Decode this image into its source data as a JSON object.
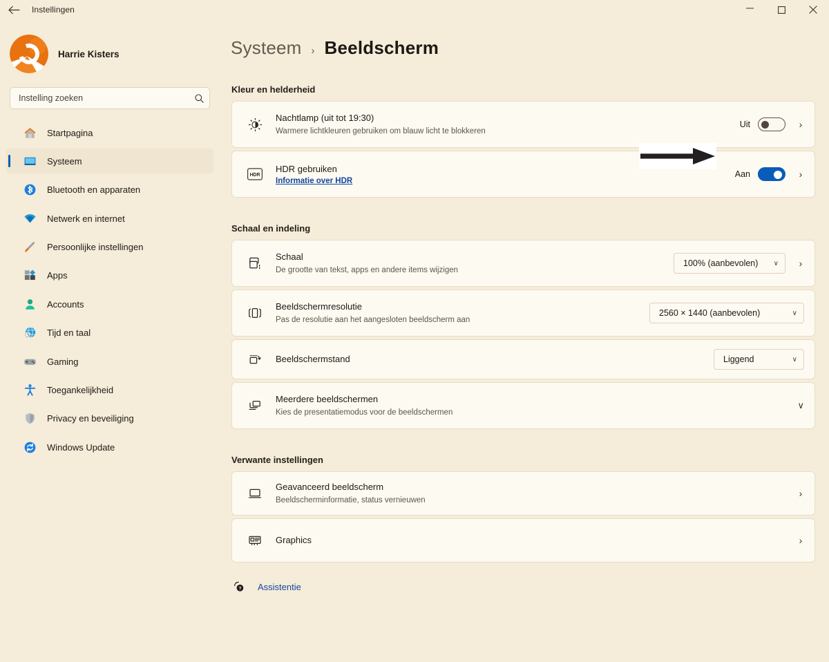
{
  "window": {
    "title": "Instellingen",
    "back_icon": "arrow-left-icon",
    "minimize_label": "–",
    "maximize_label": "□",
    "close_label": "×"
  },
  "sidebar": {
    "profile": {
      "name": "Harrie Kisters",
      "avatar_icon": "user-avatar"
    },
    "search": {
      "placeholder": "Instelling zoeken",
      "value": "",
      "icon": "search-icon"
    },
    "items": [
      {
        "label": "Startpagina",
        "icon": "home-icon",
        "active": false
      },
      {
        "label": "Systeem",
        "icon": "monitor-icon",
        "active": true
      },
      {
        "label": "Bluetooth en apparaten",
        "icon": "bluetooth-icon",
        "active": false
      },
      {
        "label": "Netwerk en internet",
        "icon": "wifi-icon",
        "active": false
      },
      {
        "label": "Persoonlijke instellingen",
        "icon": "brush-icon",
        "active": false
      },
      {
        "label": "Apps",
        "icon": "apps-icon",
        "active": false
      },
      {
        "label": "Accounts",
        "icon": "account-icon",
        "active": false
      },
      {
        "label": "Tijd en taal",
        "icon": "clock-globe-icon",
        "active": false
      },
      {
        "label": "Gaming",
        "icon": "gamepad-icon",
        "active": false
      },
      {
        "label": "Toegankelijkheid",
        "icon": "accessibility-icon",
        "active": false
      },
      {
        "label": "Privacy en beveiliging",
        "icon": "shield-icon",
        "active": false
      },
      {
        "label": "Windows Update",
        "icon": "update-icon",
        "active": false
      }
    ]
  },
  "breadcrumb": {
    "parent": "Systeem",
    "separator": "›",
    "current": "Beeldscherm"
  },
  "sections": [
    {
      "title": "Kleur en helderheid",
      "cards": [
        {
          "icon": "night-light-icon",
          "title": "Nachtlamp (uit tot 19:30)",
          "subtitle": "Warmere lichtkleuren gebruiken om blauw licht te blokkeren",
          "state_label": "Uit",
          "toggle": "off",
          "chevron": "›"
        },
        {
          "icon": "hdr-icon",
          "title": "HDR gebruiken",
          "link": "Informatie over HDR",
          "state_label": "Aan",
          "toggle": "on",
          "chevron": "›"
        }
      ]
    },
    {
      "title": "Schaal en indeling",
      "cards": [
        {
          "icon": "scale-icon",
          "title": "Schaal",
          "subtitle": "De grootte van tekst, apps en andere items wijzigen",
          "dropdown_value": "100% (aanbevolen)",
          "dropdown_caret": "∨",
          "chevron": "›"
        },
        {
          "icon": "resolution-icon",
          "title": "Beeldschermresolutie",
          "subtitle": "Pas de resolutie aan het aangesloten beeldscherm aan",
          "dropdown_value": "2560 × 1440 (aanbevolen)",
          "dropdown_caret": "∨"
        },
        {
          "icon": "orientation-icon",
          "title": "Beeldschermstand",
          "dropdown_value": "Liggend",
          "dropdown_caret": "∨"
        },
        {
          "icon": "multiple-displays-icon",
          "title": "Meerdere beeldschermen",
          "subtitle": "Kies de presentatiemodus voor de beeldschermen",
          "expander": "∨"
        }
      ]
    },
    {
      "title": "Verwante instellingen",
      "cards": [
        {
          "icon": "advanced-display-icon",
          "title": "Geavanceerd beeldscherm",
          "subtitle": "Beeldscherminformatie, status vernieuwen",
          "chevron": "›"
        },
        {
          "icon": "graphics-card-icon",
          "title": "Graphics",
          "chevron": "›"
        }
      ]
    }
  ],
  "help": {
    "label": "Assistentie",
    "icon": "help-question-icon"
  },
  "annotation": {
    "type": "arrow-right",
    "target": "night-light-toggle"
  },
  "colors": {
    "page_background": "#f5ecd9",
    "card_background": "#fdfaf2",
    "accent_blue": "#0a5cb8",
    "link_blue": "#14459c",
    "text_primary": "#1c1915",
    "text_secondary": "#5d564b"
  }
}
